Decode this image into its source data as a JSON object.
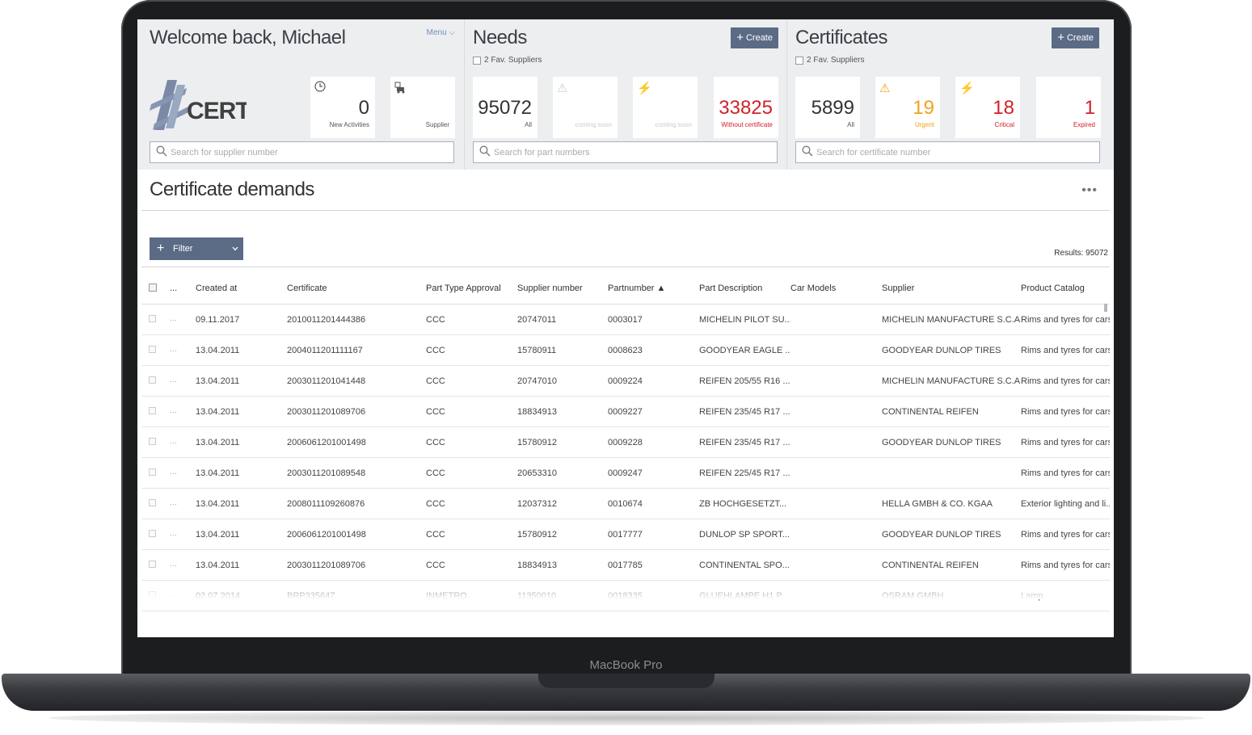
{
  "device": {
    "label": "MacBook Pro"
  },
  "welcome": {
    "title": "Welcome back, Michael",
    "menu": "Menu",
    "logo_text": "CERT",
    "tiles": [
      {
        "value": "0",
        "label": "New Activities",
        "icon": "clock-icon"
      },
      {
        "value": "",
        "label": "Supplier",
        "icon": "supplier-truck-icon"
      }
    ],
    "search_placeholder": "Search for supplier number"
  },
  "needs": {
    "title": "Needs",
    "create": "Create",
    "fav": "2 Fav. Suppliers",
    "tiles": [
      {
        "value": "95072",
        "label": "All"
      },
      {
        "value": "",
        "label": "coming soon",
        "icon": "warning-icon"
      },
      {
        "value": "",
        "label": "coming soon",
        "icon": "lightning-icon"
      },
      {
        "value": "33825",
        "label": "Without certificate",
        "color": "#d0212a"
      }
    ],
    "search_placeholder": "Search for part numbers"
  },
  "certificates": {
    "title": "Certificates",
    "create": "Create",
    "fav": "2 Fav. Suppliers",
    "tiles": [
      {
        "value": "5899",
        "label": "All"
      },
      {
        "value": "19",
        "label": "Urgent",
        "icon": "warning-icon",
        "color": "#f0a21a"
      },
      {
        "value": "18",
        "label": "Critical",
        "icon": "lightning-icon",
        "color": "#d0212a"
      },
      {
        "value": "1",
        "label": "Expired",
        "color": "#d0212a"
      }
    ],
    "search_placeholder": "Search for certificate number"
  },
  "demands": {
    "title": "Certificate demands",
    "more": "•••",
    "filter": "Filter",
    "results": "Results: 95072",
    "columns": [
      "...",
      "Created at",
      "Certificate",
      "Part Type Approval",
      "Supplier number",
      "Partnumber ▲",
      "Part Description",
      "Car Models",
      "Supplier",
      "Product Catalog"
    ],
    "rows": [
      [
        "09.11.2017",
        "2010011201444386",
        "CCC",
        "20747011",
        "0003017",
        "MICHELIN PILOT SU...",
        "",
        "MICHELIN MANUFACTURE S.C.A",
        "Rims and tyres for cars"
      ],
      [
        "13.04.2011",
        "2004011201111167",
        "CCC",
        "15780911",
        "0008623",
        "GOODYEAR EAGLE ...",
        "",
        "GOODYEAR DUNLOP TIRES",
        "Rims and tyres for cars"
      ],
      [
        "13.04.2011",
        "2003011201041448",
        "CCC",
        "20747010",
        "0009224",
        "REIFEN 205/55 R16 ...",
        "",
        "MICHELIN MANUFACTURE S.C.A",
        "Rims and tyres for cars"
      ],
      [
        "13.04.2011",
        "2003011201089706",
        "CCC",
        "18834913",
        "0009227",
        "REIFEN 235/45 R17 ...",
        "",
        "CONTINENTAL REIFEN",
        "Rims and tyres for cars"
      ],
      [
        "13.04.2011",
        "2006061201001498",
        "CCC",
        "15780912",
        "0009228",
        "REIFEN 235/45 R17 ...",
        "",
        "GOODYEAR DUNLOP TIRES",
        "Rims and tyres for cars"
      ],
      [
        "13.04.2011",
        "2003011201089548",
        "CCC",
        "20653310",
        "0009247",
        "REIFEN 225/45 R17 ...",
        "",
        "",
        "Rims and tyres for cars"
      ],
      [
        "13.04.2011",
        "2008011109260876",
        "CCC",
        "12037312",
        "0010674",
        "ZB HOCHGESETZT...",
        "",
        "HELLA GMBH & CO. KGAA",
        "Exterior lighting and li..."
      ],
      [
        "13.04.2011",
        "2006061201001498",
        "CCC",
        "15780912",
        "0017777",
        "DUNLOP SP SPORT...",
        "",
        "GOODYEAR DUNLOP TIRES",
        "Rims and tyres for cars"
      ],
      [
        "13.04.2011",
        "2003011201089706",
        "CCC",
        "18834913",
        "0017785",
        "CONTINENTAL SPO...",
        "",
        "CONTINENTAL REIFEN",
        "Rims and tyres for cars"
      ],
      [
        "02.07.2014",
        "BRP335647",
        "INMETRO",
        "11350010",
        "0018335",
        "GLUEHLAMPE H1 P...",
        "",
        "OSRAM GMBH",
        "Lamp"
      ]
    ]
  }
}
